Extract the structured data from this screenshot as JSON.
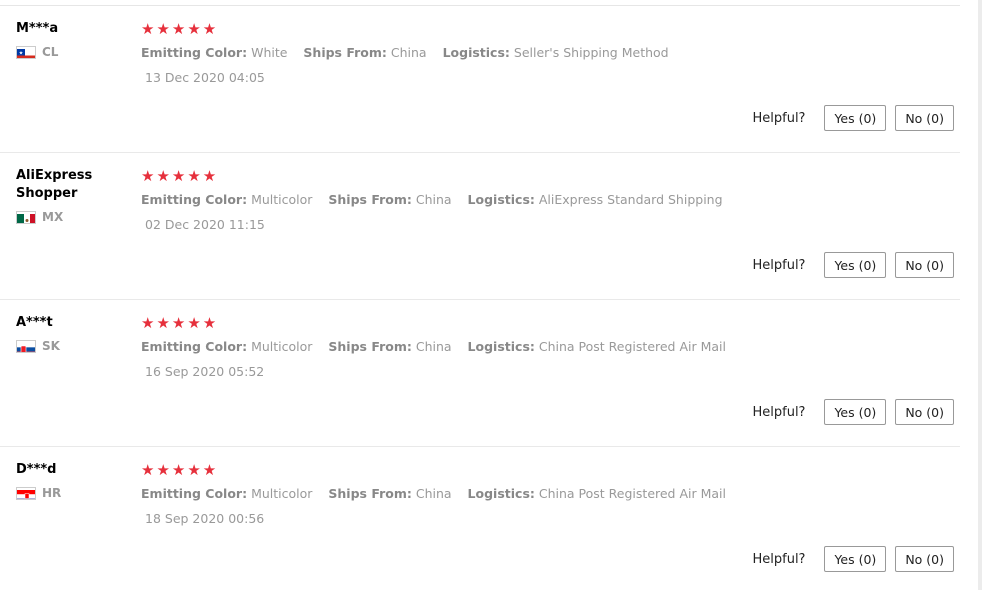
{
  "reviews": [
    {
      "user": "M***a",
      "country": "CL",
      "flag_icon": "chile-flag-icon",
      "rating_stars": "★★★★★",
      "attributes": [
        {
          "label": "Emitting Color:",
          "value": "White"
        },
        {
          "label": "Ships From:",
          "value": "China"
        },
        {
          "label": "Logistics:",
          "value": "Seller's Shipping Method"
        }
      ],
      "date": "13 Dec 2020 04:05",
      "helpful_label": "Helpful?",
      "yes_label": "Yes (0)",
      "no_label": "No (0)"
    },
    {
      "user": "AliExpress Shopper",
      "country": "MX",
      "flag_icon": "mexico-flag-icon",
      "rating_stars": "★★★★★",
      "attributes": [
        {
          "label": "Emitting Color:",
          "value": "Multicolor"
        },
        {
          "label": "Ships From:",
          "value": "China"
        },
        {
          "label": "Logistics:",
          "value": "AliExpress Standard Shipping"
        }
      ],
      "date": "02 Dec 2020 11:15",
      "helpful_label": "Helpful?",
      "yes_label": "Yes (0)",
      "no_label": "No (0)"
    },
    {
      "user": "A***t",
      "country": "SK",
      "flag_icon": "slovakia-flag-icon",
      "rating_stars": "★★★★★",
      "attributes": [
        {
          "label": "Emitting Color:",
          "value": "Multicolor"
        },
        {
          "label": "Ships From:",
          "value": "China"
        },
        {
          "label": "Logistics:",
          "value": "China Post Registered Air Mail"
        }
      ],
      "date": "16 Sep 2020 05:52",
      "helpful_label": "Helpful?",
      "yes_label": "Yes (0)",
      "no_label": "No (0)"
    },
    {
      "user": "D***d",
      "country": "HR",
      "flag_icon": "croatia-flag-icon",
      "rating_stars": "★★★★★",
      "attributes": [
        {
          "label": "Emitting Color:",
          "value": "Multicolor"
        },
        {
          "label": "Ships From:",
          "value": "China"
        },
        {
          "label": "Logistics:",
          "value": "China Post Registered Air Mail"
        }
      ],
      "date": "18 Sep 2020 00:56",
      "helpful_label": "Helpful?",
      "yes_label": "Yes (0)",
      "no_label": "No (0)"
    }
  ],
  "colors": {
    "star": "#e6303c",
    "muted_text": "#999999",
    "separator": "#e9e9e9"
  }
}
